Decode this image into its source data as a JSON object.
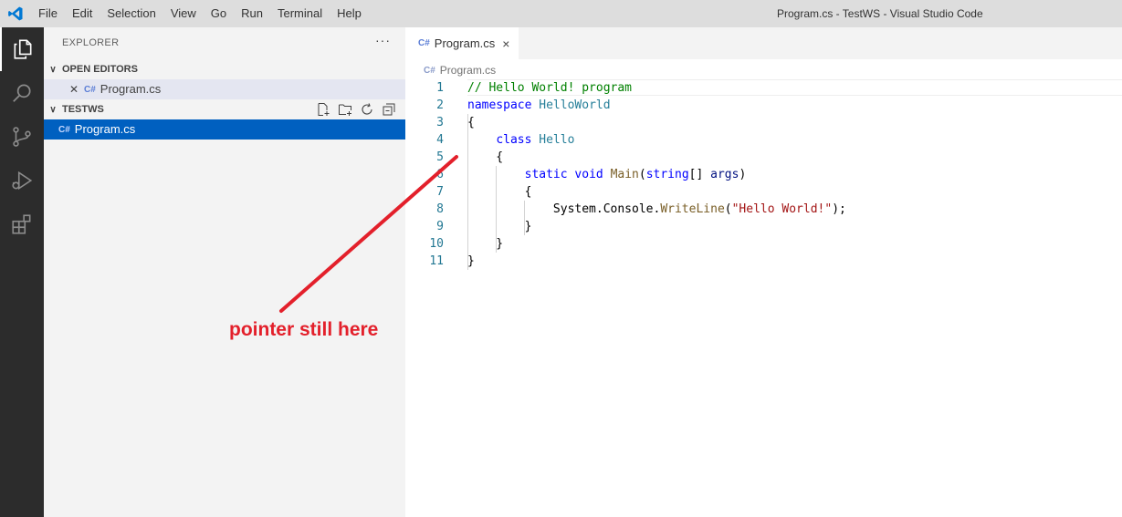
{
  "window": {
    "title": "Program.cs - TestWS - Visual Studio Code",
    "menu": [
      "File",
      "Edit",
      "Selection",
      "View",
      "Go",
      "Run",
      "Terminal",
      "Help"
    ]
  },
  "activity_bar": {
    "icons": [
      "explorer-icon",
      "search-icon",
      "source-control-icon",
      "run-debug-icon",
      "extensions-icon"
    ]
  },
  "sidebar": {
    "title": "EXPLORER",
    "more": "···",
    "open_editors": {
      "label": "OPEN EDITORS",
      "items": [
        {
          "icon": "C#",
          "name": "Program.cs"
        }
      ]
    },
    "workspace": {
      "label": "TESTWS",
      "tools": [
        "new-file-icon",
        "new-folder-icon",
        "refresh-icon",
        "collapse-all-icon"
      ],
      "items": [
        {
          "icon": "C#",
          "name": "Program.cs"
        }
      ]
    }
  },
  "editor": {
    "tab": {
      "icon": "C#",
      "label": "Program.cs",
      "close": "×"
    },
    "breadcrumb": {
      "icon": "C#",
      "label": "Program.cs"
    },
    "line_numbers": [
      "1",
      "2",
      "3",
      "4",
      "5",
      "6",
      "7",
      "8",
      "9",
      "10",
      "11"
    ],
    "code": [
      [
        {
          "t": "// Hello World! program",
          "c": "comment"
        }
      ],
      [
        {
          "t": "namespace",
          "c": "kw"
        },
        {
          "t": " ",
          "c": "plain"
        },
        {
          "t": "HelloWorld",
          "c": "type"
        }
      ],
      [
        {
          "t": "{",
          "c": "plain"
        }
      ],
      [
        {
          "t": "    ",
          "c": "plain"
        },
        {
          "t": "class",
          "c": "kw"
        },
        {
          "t": " ",
          "c": "plain"
        },
        {
          "t": "Hello",
          "c": "type"
        }
      ],
      [
        {
          "t": "    {",
          "c": "plain"
        }
      ],
      [
        {
          "t": "        ",
          "c": "plain"
        },
        {
          "t": "static",
          "c": "kw"
        },
        {
          "t": " ",
          "c": "plain"
        },
        {
          "t": "void",
          "c": "kw"
        },
        {
          "t": " ",
          "c": "plain"
        },
        {
          "t": "Main",
          "c": "fn"
        },
        {
          "t": "(",
          "c": "plain"
        },
        {
          "t": "string",
          "c": "kw"
        },
        {
          "t": "[] ",
          "c": "plain"
        },
        {
          "t": "args",
          "c": "param"
        },
        {
          "t": ")",
          "c": "plain"
        }
      ],
      [
        {
          "t": "        {",
          "c": "plain"
        }
      ],
      [
        {
          "t": "            System.Console.",
          "c": "plain"
        },
        {
          "t": "WriteLine",
          "c": "fn"
        },
        {
          "t": "(",
          "c": "plain"
        },
        {
          "t": "\"Hello World!\"",
          "c": "str"
        },
        {
          "t": ");",
          "c": "plain"
        }
      ],
      [
        {
          "t": "        }",
          "c": "plain"
        }
      ],
      [
        {
          "t": "    }",
          "c": "plain"
        }
      ],
      [
        {
          "t": "}",
          "c": "plain"
        }
      ]
    ]
  },
  "annotation": {
    "text": "pointer still here",
    "color": "#e3202b"
  }
}
